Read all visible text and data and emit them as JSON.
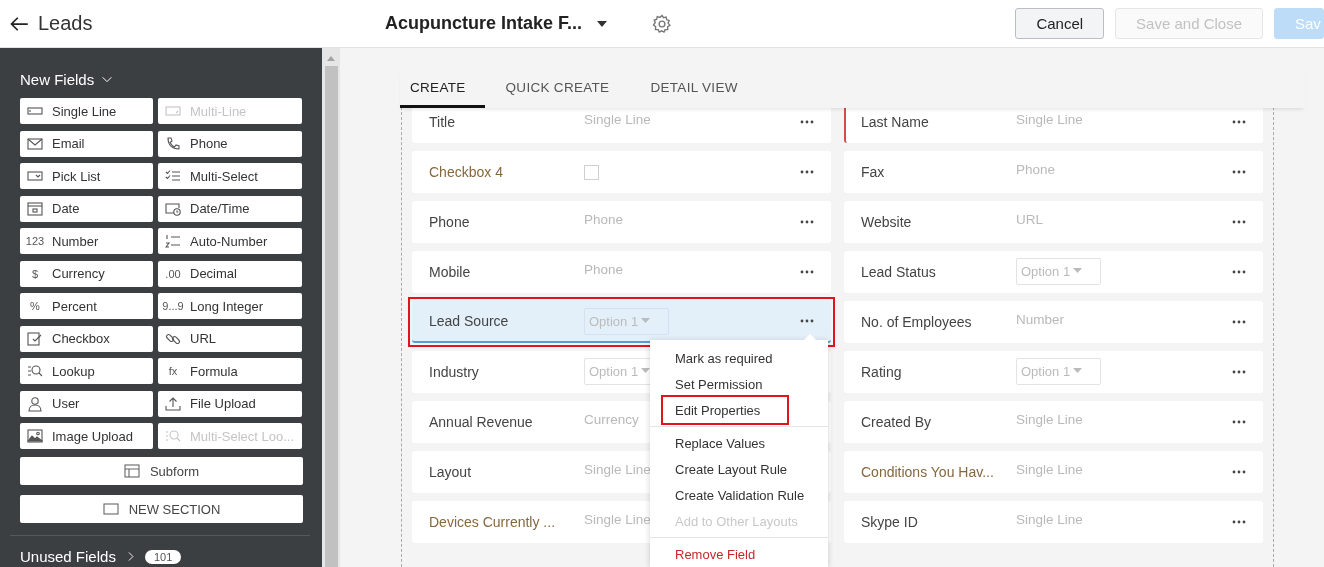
{
  "header": {
    "back_label": "Leads",
    "layout_title": "Acupuncture Intake F...",
    "buttons": [
      {
        "label": "Cancel",
        "kind": "secondary",
        "disabled": false
      },
      {
        "label": "Save and Close",
        "kind": "secondary",
        "disabled": true
      },
      {
        "label": "Sav",
        "kind": "primary",
        "disabled": true
      }
    ]
  },
  "sidebar": {
    "title": "New Fields",
    "expanded": true,
    "field_types": [
      {
        "label": "Single Line",
        "disabled": false
      },
      {
        "label": "Multi-Line",
        "disabled": true
      },
      {
        "label": "Email",
        "disabled": false
      },
      {
        "label": "Phone",
        "disabled": false
      },
      {
        "label": "Pick List",
        "disabled": false
      },
      {
        "label": "Multi-Select",
        "disabled": false
      },
      {
        "label": "Date",
        "disabled": false
      },
      {
        "label": "Date/Time",
        "disabled": false
      },
      {
        "label": "Number",
        "glyph": "123",
        "disabled": false
      },
      {
        "label": "Auto-Number",
        "disabled": false
      },
      {
        "label": "Currency",
        "glyph": "$",
        "disabled": false
      },
      {
        "label": "Decimal",
        "glyph": ".00",
        "disabled": false
      },
      {
        "label": "Percent",
        "glyph": "%",
        "disabled": false
      },
      {
        "label": "Long Integer",
        "glyph": "9...9",
        "disabled": false
      },
      {
        "label": "Checkbox",
        "disabled": false
      },
      {
        "label": "URL",
        "disabled": false
      },
      {
        "label": "Lookup",
        "disabled": false
      },
      {
        "label": "Formula",
        "glyph": "fx",
        "disabled": false
      },
      {
        "label": "User",
        "disabled": false
      },
      {
        "label": "File Upload",
        "disabled": false
      },
      {
        "label": "Image Upload",
        "disabled": false
      },
      {
        "label": "Multi-Select Loo...",
        "disabled": true
      }
    ],
    "wide_buttons": [
      {
        "label": "Subform",
        "kind": "subform"
      },
      {
        "label": "NEW SECTION",
        "kind": "section"
      }
    ],
    "unused": {
      "label": "Unused Fields",
      "count": "101",
      "expanded": false
    }
  },
  "tabs": [
    {
      "label": "CREATE",
      "selected": true
    },
    {
      "label": "QUICK CREATE",
      "selected": false
    },
    {
      "label": "DETAIL VIEW",
      "selected": false
    }
  ],
  "fields": {
    "left": [
      {
        "label": "Title",
        "kind": "text",
        "value": "Single Line",
        "custom": false,
        "required": false,
        "selected": false,
        "annotated": false
      },
      {
        "label": "Checkbox 4",
        "kind": "checkbox",
        "checked": false,
        "custom": true,
        "required": false,
        "selected": false,
        "annotated": false
      },
      {
        "label": "Phone",
        "kind": "text",
        "value": "Phone",
        "custom": false,
        "required": false,
        "selected": false,
        "annotated": false
      },
      {
        "label": "Mobile",
        "kind": "text",
        "value": "Phone",
        "custom": false,
        "required": false,
        "selected": false,
        "annotated": false
      },
      {
        "label": "Lead Source",
        "kind": "picklist",
        "value": "Option 1",
        "custom": false,
        "required": false,
        "selected": true,
        "annotated": true
      },
      {
        "label": "Industry",
        "kind": "picklist",
        "value": "Option 1",
        "custom": false,
        "required": false,
        "selected": false,
        "annotated": false
      },
      {
        "label": "Annual Revenue",
        "kind": "text",
        "value": "Currency",
        "custom": false,
        "required": false,
        "selected": false,
        "annotated": false
      },
      {
        "label": "Layout",
        "kind": "text",
        "value": "Single Line",
        "custom": false,
        "required": false,
        "selected": false,
        "annotated": false
      },
      {
        "label": "Devices Currently ...",
        "kind": "text",
        "value": "Single Line",
        "custom": true,
        "required": false,
        "selected": false,
        "annotated": false
      }
    ],
    "right": [
      {
        "label": "Last Name",
        "kind": "text",
        "value": "Single Line",
        "custom": false,
        "required": true,
        "selected": false,
        "annotated": false
      },
      {
        "label": "Fax",
        "kind": "text",
        "value": "Phone",
        "custom": false,
        "required": false,
        "selected": false,
        "annotated": false
      },
      {
        "label": "Website",
        "kind": "text",
        "value": "URL",
        "custom": false,
        "required": false,
        "selected": false,
        "annotated": false
      },
      {
        "label": "Lead Status",
        "kind": "picklist",
        "value": "Option 1",
        "custom": false,
        "required": false,
        "selected": false,
        "annotated": false
      },
      {
        "label": "No. of Employees",
        "kind": "text",
        "value": "Number",
        "custom": false,
        "required": false,
        "selected": false,
        "annotated": false
      },
      {
        "label": "Rating",
        "kind": "picklist",
        "value": "Option 1",
        "custom": false,
        "required": false,
        "selected": false,
        "annotated": false
      },
      {
        "label": "Created By",
        "kind": "text",
        "value": "Single Line",
        "custom": false,
        "required": false,
        "selected": false,
        "annotated": false
      },
      {
        "label": "Conditions You Hav...",
        "kind": "text",
        "value": "Single Line",
        "custom": true,
        "required": false,
        "selected": false,
        "annotated": false
      },
      {
        "label": "Skype ID",
        "kind": "text",
        "value": "Single Line",
        "custom": false,
        "required": false,
        "selected": false,
        "annotated": false
      }
    ]
  },
  "context_menu": {
    "sections": [
      [
        {
          "label": "Mark as required",
          "kind": "normal",
          "disabled": false,
          "annotated": false
        },
        {
          "label": "Set Permission",
          "kind": "normal",
          "disabled": false,
          "annotated": false
        },
        {
          "label": "Edit Properties",
          "kind": "normal",
          "disabled": false,
          "annotated": true
        }
      ],
      [
        {
          "label": "Replace Values",
          "kind": "normal",
          "disabled": false,
          "annotated": false
        },
        {
          "label": "Create Layout Rule",
          "kind": "normal",
          "disabled": false,
          "annotated": false
        },
        {
          "label": "Create Validation Rule",
          "kind": "normal",
          "disabled": false,
          "annotated": false
        },
        {
          "label": "Add to Other Layouts",
          "kind": "normal",
          "disabled": true,
          "annotated": false
        }
      ],
      [
        {
          "label": "Remove Field",
          "kind": "danger",
          "disabled": false,
          "annotated": false
        }
      ]
    ]
  }
}
